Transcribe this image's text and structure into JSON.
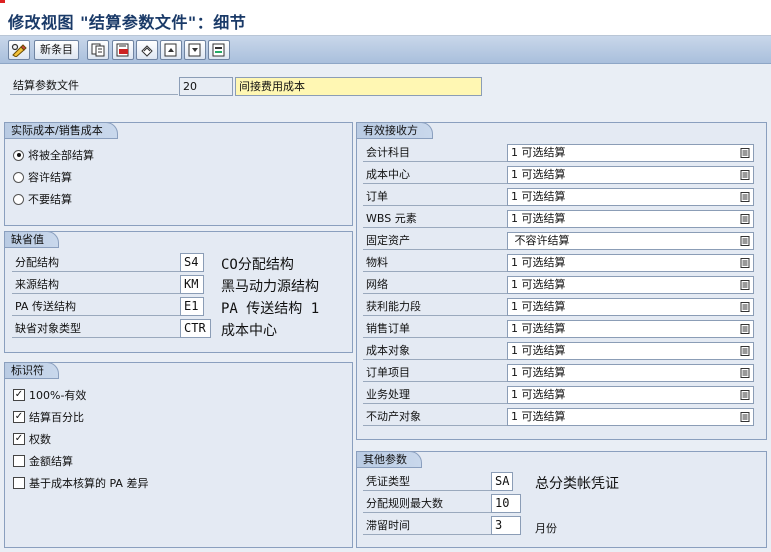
{
  "window": {
    "title": "修改视图 \"结算参数文件\"：细节"
  },
  "toolbar": {
    "new_entries_label": "新条目",
    "icons": [
      "display-change-icon",
      "copy-icon",
      "delete-icon",
      "undo-icon",
      "prev-entry-icon",
      "next-entry-icon",
      "other-entry-icon"
    ]
  },
  "header": {
    "profile_label": "结算参数文件",
    "profile_value": "20",
    "profile_desc": "间接费用成本"
  },
  "actual_costs": {
    "title": "实际成本/销售成本",
    "options": [
      {
        "label": "将被全部结算",
        "selected": true
      },
      {
        "label": "容许结算",
        "selected": false
      },
      {
        "label": "不要结算",
        "selected": false
      }
    ]
  },
  "defaults": {
    "title": "缺省值",
    "rows": [
      {
        "label": "分配结构",
        "value": "S4",
        "desc": "CO分配结构"
      },
      {
        "label": "来源结构",
        "value": "KM",
        "desc": "黑马动力源结构"
      },
      {
        "label": "PA 传送结构",
        "value": "E1",
        "desc": "PA 传送结构 1"
      },
      {
        "label": "缺省对象类型",
        "value": "CTR",
        "desc": "成本中心"
      }
    ]
  },
  "indicators": {
    "title": "标识符",
    "items": [
      {
        "label": "100%-有效",
        "checked": true
      },
      {
        "label": "结算百分比",
        "checked": true
      },
      {
        "label": "权数",
        "checked": true
      },
      {
        "label": "金额结算",
        "checked": false
      },
      {
        "label": "基于成本核算的 PA 差异",
        "checked": false
      }
    ]
  },
  "receivers": {
    "title": "有效接收方",
    "rows": [
      {
        "label": "会计科目",
        "value": "1 可选结算"
      },
      {
        "label": "成本中心",
        "value": "1 可选结算"
      },
      {
        "label": "订单",
        "value": "1 可选结算"
      },
      {
        "label": "WBS 元素",
        "value": "1 可选结算"
      },
      {
        "label": "固定资产",
        "value": " 不容许结算"
      },
      {
        "label": "物料",
        "value": "1 可选结算"
      },
      {
        "label": "网络",
        "value": "1 可选结算"
      },
      {
        "label": "获利能力段",
        "value": "1 可选结算"
      },
      {
        "label": "销售订单",
        "value": "1 可选结算"
      },
      {
        "label": "成本对象",
        "value": "1 可选结算"
      },
      {
        "label": "订单项目",
        "value": "1 可选结算"
      },
      {
        "label": "业务处理",
        "value": "1 可选结算"
      },
      {
        "label": "不动产对象",
        "value": "1 可选结算"
      }
    ]
  },
  "other_params": {
    "title": "其他参数",
    "doc_type_label": "凭证类型",
    "doc_type_value": "SA",
    "doc_type_desc": "总分类帐凭证",
    "max_rules_label": "分配规则最大数",
    "max_rules_value": "10",
    "retention_label": "滞留时间",
    "retention_value": "3",
    "retention_unit": "月份"
  }
}
